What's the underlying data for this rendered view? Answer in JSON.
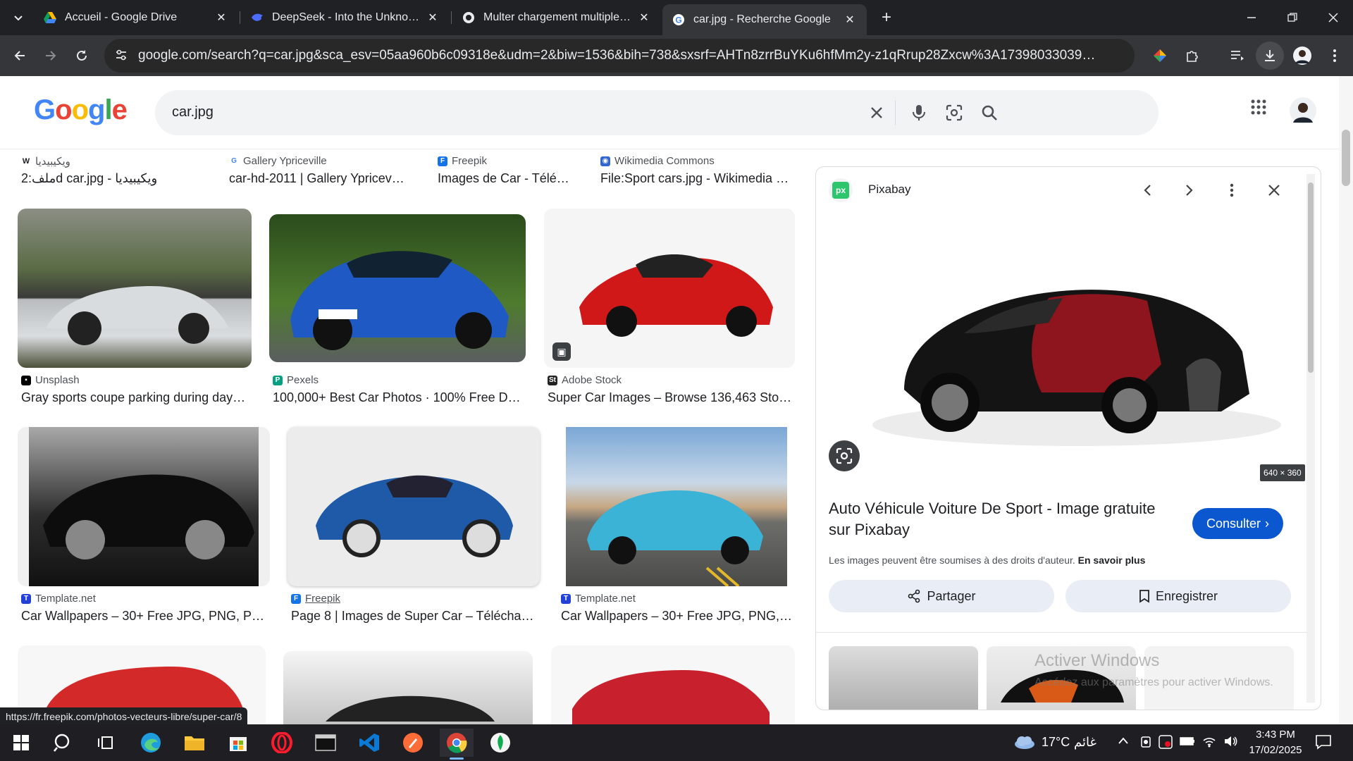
{
  "browser": {
    "tabs": [
      {
        "label": "Accueil - Google Drive",
        "icon": "google-drive-icon"
      },
      {
        "label": "DeepSeek - Into the Unknown",
        "icon": "deepseek-icon"
      },
      {
        "label": "Multer chargement multiple im…",
        "icon": "github-icon"
      },
      {
        "label": "car.jpg - Recherche Google",
        "icon": "google-icon",
        "active": true
      }
    ],
    "url": "google.com/search?q=car.jpg&sca_esv=05aa960b6c09318e&udm=2&biw=1536&bih=738&sxsrf=AHTn8zrrBuYKu6hfMm2y-z1qRrup28Zxcw%3A1739803303990&ei=p0qzZ-…"
  },
  "google": {
    "logo": "Google",
    "query": "car.jpg"
  },
  "results_top": [
    {
      "source": "ويكيبيديا",
      "title": "ملف:2d car.jpg - ويكيبيديا"
    },
    {
      "source": "Gallery Ypriceville",
      "title": "car-hd-2011 | Gallery Ypricev…"
    },
    {
      "source": "Freepik",
      "title": "Images de Car - Télé…"
    },
    {
      "source": "Wikimedia Commons",
      "title": "File:Sport cars.jpg - Wikimedia …"
    }
  ],
  "results_row1": [
    {
      "source": "Unsplash",
      "title": "Gray sports coupe parking during day…"
    },
    {
      "source": "Pexels",
      "title": "100,000+ Best Car Photos · 100% Free D…"
    },
    {
      "source": "Adobe Stock",
      "title": "Super Car Images – Browse 136,463 Sto…"
    }
  ],
  "results_row2": [
    {
      "source": "Template.net",
      "title": "Car Wallpapers – 30+ Free JPG, PNG, P…"
    },
    {
      "source": "Freepik",
      "title": "Page 8 | Images de Super Car – Télécha…"
    },
    {
      "source": "Template.net",
      "title": "Car Wallpapers – 30+ Free JPG, PNG,…"
    }
  ],
  "panel": {
    "source": "Pixabay",
    "source_badge": "px",
    "dims": "640 × 360",
    "title": "Auto Véhicule Voiture De Sport - Image gratuite sur Pixabay",
    "visit": "Consulter",
    "copyright": "Les images peuvent être soumises à des droits d'auteur.",
    "learn_more": "En savoir plus",
    "share": "Partager",
    "save": "Enregistrer"
  },
  "watermark": {
    "line1": "Activer Windows",
    "line2": "Accédez aux paramètres pour activer Windows."
  },
  "status_url": "https://fr.freepik.com/photos-vecteurs-libre/super-car/8",
  "taskbar": {
    "weather": "17°C",
    "weather_text": "غائم",
    "time": "3:43 PM",
    "date": "17/02/2025"
  },
  "colors": {
    "accent": "#0b57d0",
    "panel_btn": "#e9eef6",
    "dark_chrome": "#202124"
  }
}
